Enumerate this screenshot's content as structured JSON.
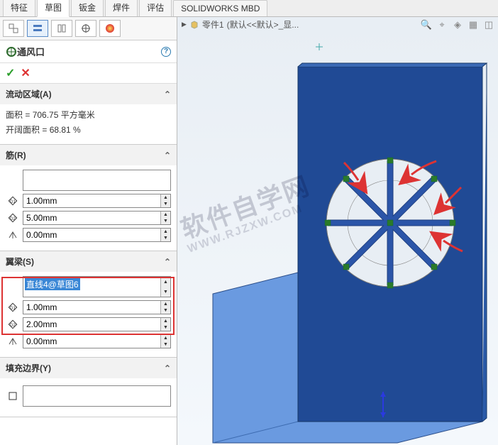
{
  "tabs": [
    "特征",
    "草图",
    "钣金",
    "焊件",
    "评估",
    "SOLIDWORKS MBD"
  ],
  "active_tab": 1,
  "panel": {
    "feature_title": "通风口",
    "ok_glyph": "✓",
    "cancel_glyph": "✕",
    "flow": {
      "header": "流动区域(A)",
      "area_label": "面积 =",
      "area_value": "706.75 平方毫米",
      "open_label": "开阔面积 =",
      "open_value": "68.81 %"
    },
    "rib": {
      "header": "筋(R)",
      "d1": "1.00mm",
      "d2": "5.00mm",
      "d3": "0.00mm"
    },
    "spar": {
      "header": "翼梁(S)",
      "selected": "直线4@草图6",
      "d1": "1.00mm",
      "d2": "2.00mm",
      "d3": "0.00mm"
    },
    "fill": {
      "header": "填充边界(Y)"
    }
  },
  "crumb": {
    "part": "零件1",
    "state": "(默认<<默认>_显..."
  },
  "watermark": {
    "line1": "软件自学网",
    "line2": "WWW.RJZXW.COM"
  },
  "icons": {
    "d1": "D1",
    "d2": "D2"
  }
}
